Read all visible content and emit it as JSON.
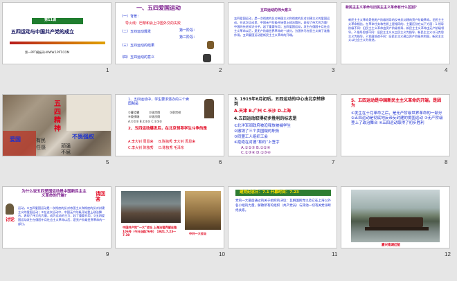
{
  "slides": [
    {
      "num": "1",
      "tag": "第11课",
      "title": "五四运动与中国共产党的成立",
      "footer": "第一PPT模板网-WWW.1PPT.COM"
    },
    {
      "num": "2",
      "heading": "一、五四爱国运动",
      "lines": [
        "（一）背景：",
        "导火线：巴黎和会上中国外交的失败",
        "（二）五四运动爆发",
        "第一阶段：",
        "第二阶段：",
        "（三）五四运动的结果",
        "（四）五四运动的意义"
      ]
    },
    {
      "num": "3",
      "heading": "五四运动的伟大意义",
      "body": "五四爱国运动，是一次彻底的反对帝国主义和彻底的反对封建主义的爱国运动。在这次运动里，中国无产阶级开始登上政治舞台，表现了伟大的力量！中国的先进知识分子，起了重要作用；五四爱国运动，发生在俄国十月社会主义革命以后，是无产阶级世界革命的一部分，为国传马克思主义做了准备作用。五四爱国运动是新民主主义革命的开端。"
    },
    {
      "num": "4",
      "heading": "新民主主义革命与旧民主主义革命有什么区别?",
      "body": "新民主主义革命是指无产阶级领导的反帝反封建的资产阶级革命。旧民主主义革命相比，在革命任务和性质上是相同的，主要区别在以下方面：1.领导阶级不同：旧民主主义革命由资产阶级领导，新民主主义革命由无产阶级领导。2.指导思想不同：旧民主主义以三民主义为指导，新民主主义以马克思主义为指导。3.发展前途不同：旧民主主义建立资产阶级共和国，新民主主义以社会主义为前途。"
    },
    {
      "num": "5",
      "words": [
        "五",
        "四",
        "精",
        "神",
        "爱国",
        "有民",
        "不畏强权",
        "顽强",
        "不屈",
        "任感"
      ]
    },
    {
      "num": "6",
      "q1": "1、五四运动中，学生要求惩办的三个卖国贼是",
      "opts1": [
        "①曹汝霖",
        "②陆宗舆",
        "③章宗祥",
        "④段祺瑞",
        "⑤陆宗舆"
      ],
      "opts1b": "A.①②③ B.①②⑤ C.①③⑤",
      "q2": "2、五四运动爆发后，在北京领导学生斗争的是",
      "opts2": [
        "A.李大钊 周恩来",
        "B.陈独秀 李大钊 周恩来",
        "C.李大钊 陈独秀",
        "D.陈独秀 毛泽东"
      ]
    },
    {
      "num": "7",
      "q3": "3. 1919年6月初后，五四运动的中心由北京转移到",
      "opts3": "A.天津 B.广州 C.长沙 D.上海",
      "q4": "4.五四运动取得初步胜利的标志是",
      "items": [
        "①北洋军阀政府被迫释放被捕学生",
        "②撤销了三个卖国贼的职务",
        "③同盟工人组织工会",
        "④拒绝在对德“和约”上签字"
      ],
      "opts4a": "A.①②③  B.①②④",
      "opts4b": "C.②③④  D.①③④"
    },
    {
      "num": "8",
      "q5": "5、五四运动是中国新民主主义革命的开端，是因为",
      "ans": "①发生在十月革命之后，是无产阶级世界革命的一部分 ②五四运动是彻底地反帝反封建的爱国运动 ③无产阶级登上了政治舞台 ④五四运动取得了初步胜利"
    },
    {
      "num": "9",
      "question": "为什么说五四爱国运动是中国新民主主义革命的开端?",
      "stamp": "请回答",
      "tag": "讨论",
      "body": "运动，①五四爱国运动是一次彻底的反对帝国主义和彻底的反对封建主义的爱国运动；②在这次运动中，中国无产阶级开始登上政治舞台，表现了伟大的力量，成为运动的主力，起了重要作用；③五四爱国运动发生在俄国十月社会主义革命以后，是无产阶级世界革命的一部分。"
    },
    {
      "num": "10",
      "caption": "中国共产党“一大”会址\n上海法租界望志路106号（今兴业路76号）\n1921.7.23～7.30",
      "label": "中共一大会址"
    },
    {
      "num": "11",
      "header": "建党纪念日：7.1 开幕时间：7.23",
      "body": "党的一大最后通过的关于组织的决议：瓦解国民党以及它在上海以外各小组的力量，解散所有的组织（共产党员）与其他一切有关党派断绝关系。"
    },
    {
      "num": "12",
      "label": "嘉兴南湖红船"
    }
  ],
  "colors": {
    "red": "#e0001b",
    "blue": "#1a2fd0",
    "purple": "#7a1b8c",
    "border": "#c4c4c4",
    "bg": "#e6e6e6"
  }
}
